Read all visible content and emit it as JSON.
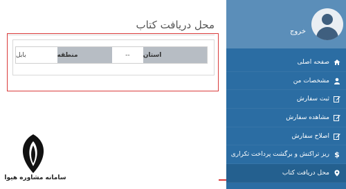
{
  "page": {
    "title": "محل دریافت کتاب"
  },
  "user": {
    "logout_label": "خروج"
  },
  "sidebar": {
    "items": [
      {
        "label": "صفحه اصلی",
        "icon": "home-icon"
      },
      {
        "label": "مشخصات من",
        "icon": "user-icon"
      },
      {
        "label": "ثبت سفارش",
        "icon": "edit-icon"
      },
      {
        "label": "مشاهده سفارش",
        "icon": "edit-icon"
      },
      {
        "label": "اصلاح سفارش",
        "icon": "edit-icon"
      },
      {
        "label": "ریز تراکنش و برگشت پرداخت تکراری",
        "icon": "dollar-icon"
      },
      {
        "label": "محل دریافت کتاب",
        "icon": "map-marker-icon"
      }
    ]
  },
  "location": {
    "province_label": "استان",
    "province_value": "--",
    "region_label": "منطقه",
    "region_value": "بابل"
  },
  "watermark": {
    "text": "سامانه مشاوره هیوا"
  },
  "colors": {
    "sidebar": "#2b6da3",
    "highlight": "#d93a3a",
    "header_cell": "#b7bdc4"
  }
}
